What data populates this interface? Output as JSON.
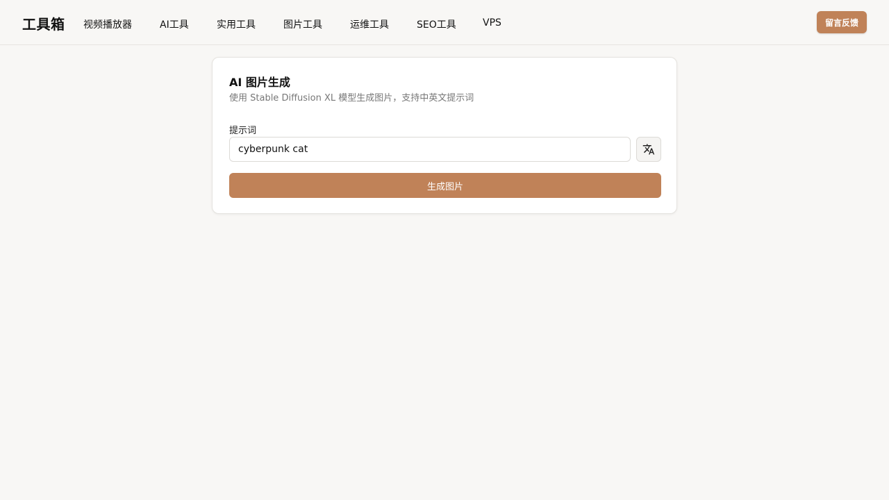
{
  "header": {
    "logo": "工具箱",
    "nav": [
      {
        "label": "视频播放器"
      },
      {
        "label": "AI工具"
      },
      {
        "label": "实用工具"
      },
      {
        "label": "图片工具"
      },
      {
        "label": "运维工具"
      },
      {
        "label": "SEO工具"
      },
      {
        "label": "VPS"
      }
    ],
    "feedback_label": "留言反馈"
  },
  "main": {
    "title": "AI 图片生成",
    "description": "使用 Stable Diffusion XL 模型生成图片，支持中英文提示词",
    "prompt_label": "提示词",
    "prompt_value": "cyberpunk cat",
    "translate_icon": "translate-icon",
    "generate_label": "生成图片"
  },
  "colors": {
    "accent": "#c08258",
    "background": "#f8f7f5"
  }
}
